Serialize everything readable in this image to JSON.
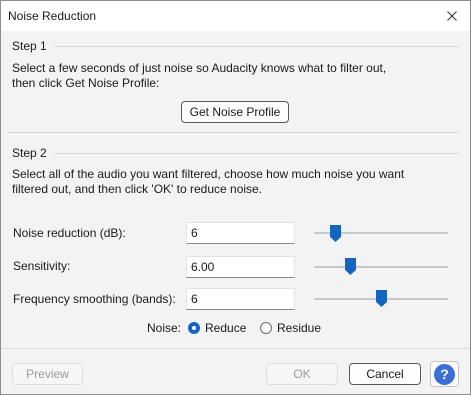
{
  "window": {
    "title": "Noise Reduction"
  },
  "step1": {
    "heading": "Step 1",
    "text_line1": "Select a few seconds of just noise so Audacity knows what to filter out,",
    "text_line2": "then click Get Noise Profile:",
    "button": "Get Noise Profile"
  },
  "step2": {
    "heading": "Step 2",
    "text_line1": "Select all of the audio you want filtered, choose how much noise you want",
    "text_line2": "filtered out, and then click 'OK' to reduce noise."
  },
  "controls": {
    "noise_reduction": {
      "label": "Noise reduction (dB):",
      "value": "6",
      "slider_fraction": 0.16
    },
    "sensitivity": {
      "label": "Sensitivity:",
      "value": "6.00",
      "slider_fraction": 0.27
    },
    "frequency_smoothing": {
      "label": "Frequency smoothing (bands):",
      "value": "6",
      "slider_fraction": 0.5
    }
  },
  "noise_mode": {
    "label": "Noise:",
    "options": [
      "Reduce",
      "Residue"
    ],
    "selected": "Reduce"
  },
  "footer": {
    "preview": "Preview",
    "ok": "OK",
    "cancel": "Cancel",
    "help": "?"
  },
  "colors": {
    "accent": "#1565c0",
    "help": "#3b6fd6"
  }
}
